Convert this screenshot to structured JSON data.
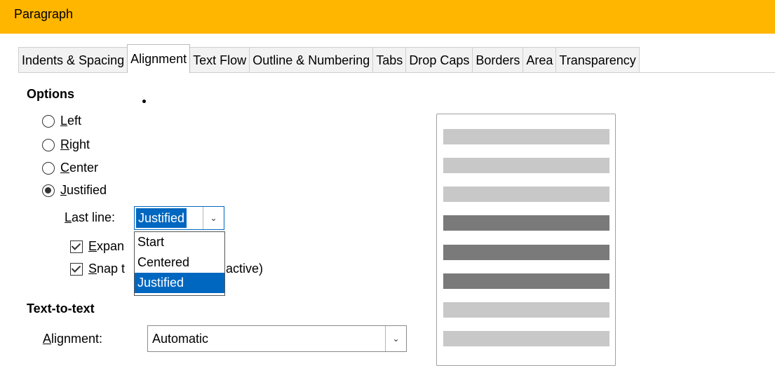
{
  "window": {
    "title": "Paragraph"
  },
  "tabs": [
    {
      "label": "Indents & Spacing",
      "active": false
    },
    {
      "label": "Alignment",
      "active": true
    },
    {
      "label": "Text Flow",
      "active": false
    },
    {
      "label": "Outline & Numbering",
      "active": false
    },
    {
      "label": "Tabs",
      "active": false
    },
    {
      "label": "Drop Caps",
      "active": false
    },
    {
      "label": "Borders",
      "active": false
    },
    {
      "label": "Area",
      "active": false
    },
    {
      "label": "Transparency",
      "active": false
    }
  ],
  "options": {
    "heading": "Options",
    "radios": [
      {
        "mnemonic": "L",
        "rest": "eft",
        "checked": false
      },
      {
        "mnemonic": "R",
        "rest": "ight",
        "checked": false
      },
      {
        "mnemonic": "C",
        "rest": "enter",
        "checked": false
      },
      {
        "mnemonic": "J",
        "rest": "ustified",
        "checked": true
      }
    ],
    "last_line": {
      "label_mnemonic": "L",
      "label_rest": "ast line:",
      "value": "Justified",
      "options": [
        "Start",
        "Centered",
        "Justified"
      ],
      "selected": "Justified"
    },
    "expand_single_word": {
      "mnemonic": "E",
      "visible_rest": "xpan",
      "checked": true
    },
    "snap_to_grid": {
      "mnemonic": "S",
      "visible_rest": "nap t",
      "checked": true,
      "suffix": "active)"
    }
  },
  "text_to_text": {
    "heading": "Text-to-text",
    "alignment_label_mnemonic": "A",
    "alignment_label_rest": "lignment:",
    "alignment_value": "Automatic"
  },
  "preview": {
    "lines": [
      "light",
      "light",
      "light",
      "dark",
      "dark",
      "dark",
      "light",
      "light"
    ]
  },
  "colors": {
    "titlebar": "#ffb600",
    "selection": "#0067c0",
    "preview_light": "#c8c8c8",
    "preview_dark": "#7a7a7a"
  }
}
